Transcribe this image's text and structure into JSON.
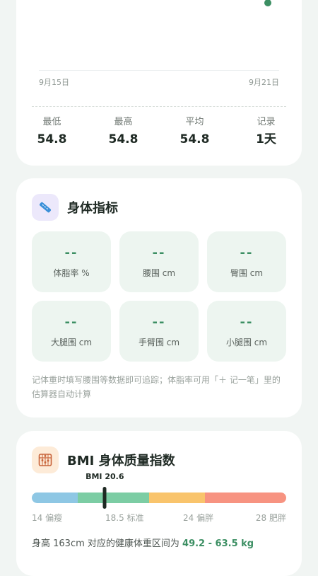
{
  "trend": {
    "x_start_label": "9月15日",
    "x_end_label": "9月21日",
    "chart_data": {
      "type": "line",
      "x": [
        "9月21日"
      ],
      "values": [
        54.8
      ],
      "x_labels": [
        "9月15日",
        "9月21日"
      ]
    },
    "stats": [
      {
        "label": "最低",
        "value": "54.8"
      },
      {
        "label": "最高",
        "value": "54.8"
      },
      {
        "label": "平均",
        "value": "54.8"
      },
      {
        "label": "记录",
        "value": "1天"
      }
    ]
  },
  "body_metrics": {
    "icon": "tape-measure-icon",
    "title": "身体指标",
    "tiles": [
      {
        "value": "--",
        "label": "体脂率 %"
      },
      {
        "value": "--",
        "label": "腰围 cm"
      },
      {
        "value": "--",
        "label": "臀围 cm"
      },
      {
        "value": "--",
        "label": "大腿围 cm"
      },
      {
        "value": "--",
        "label": "手臂围 cm"
      },
      {
        "value": "--",
        "label": "小腿围 cm"
      }
    ],
    "hint": "记体重时填写腰围等数据即可追踪；体脂率可用「＋ 记一笔」里的估算器自动计算"
  },
  "bmi": {
    "icon": "abacus-icon",
    "title": "BMI 身体质量指数",
    "marker_label": "BMI 20.6",
    "value": 20.6,
    "scale_min": 14,
    "scale_max": 28,
    "segments": [
      {
        "from": 14,
        "to": 18.5,
        "color": "#8ec7e4"
      },
      {
        "from": 18.5,
        "to": 24,
        "color": "#7ccda4"
      },
      {
        "from": 24,
        "to": 28,
        "color": "#f9c46c"
      },
      {
        "from": 28,
        "to": 32,
        "color": "#f79381"
      }
    ],
    "ticks": [
      "14 偏瘦",
      "18.5 标准",
      "24 偏胖",
      "28 肥胖"
    ],
    "note_prefix": "身高 163cm 对应的健康体重区间为 ",
    "healthy_range": "49.2 - 63.5 kg"
  },
  "colors": {
    "accent": "#3c8f63",
    "background": "#f1f5f3",
    "tile_background": "#edf5f0",
    "body_icon_bg": "#ece8fb",
    "bmi_icon_bg": "#fdebd8"
  }
}
